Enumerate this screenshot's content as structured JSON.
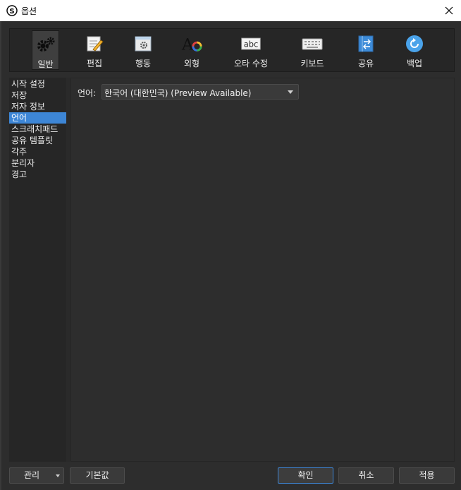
{
  "window": {
    "title": "옵션",
    "app_icon": "app-logo-icon",
    "close_icon": "close-icon"
  },
  "toolbar": {
    "items": [
      {
        "label": "일반",
        "icon": "gears-icon",
        "active": true
      },
      {
        "label": "편집",
        "icon": "pencil-note-icon",
        "active": false
      },
      {
        "label": "행동",
        "icon": "window-gear-icon",
        "active": false
      },
      {
        "label": "외형",
        "icon": "font-color-wheel-icon",
        "active": false
      },
      {
        "label": "오타 수정",
        "icon": "abc-spellcheck-icon",
        "active": false
      },
      {
        "label": "키보드",
        "icon": "keyboard-icon",
        "active": false
      },
      {
        "label": "공유",
        "icon": "share-arrows-icon",
        "active": false
      },
      {
        "label": "백업",
        "icon": "backup-circle-icon",
        "active": false
      }
    ]
  },
  "categories": {
    "items": [
      "시작 설정",
      "저장",
      "저자 정보",
      "언어",
      "스크래치패드",
      "공유 템플릿",
      "각주",
      "분리자",
      "경고"
    ],
    "selected": "언어"
  },
  "language": {
    "label": "언어:",
    "value": "한국어 (대한민국) (Preview Available)"
  },
  "buttons": {
    "manage": "관리",
    "defaults": "기본값",
    "ok": "확인",
    "cancel": "취소",
    "apply": "적용"
  },
  "colors": {
    "accent": "#3d86d6",
    "background": "#2d2d2d"
  }
}
